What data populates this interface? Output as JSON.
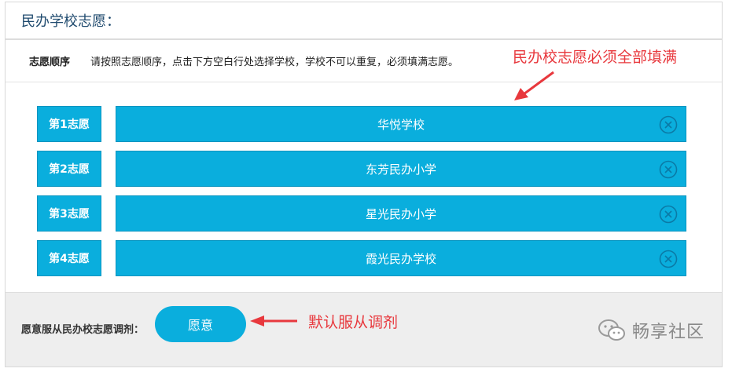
{
  "header": {
    "title": "民办学校志愿："
  },
  "instructions": {
    "label": "志愿顺序",
    "text": "请按照志愿顺序，点击下方空白行处选择学校，学校不可以重复，必须填满志愿。"
  },
  "choices": [
    {
      "rank": "第1志愿",
      "school": "华悦学校"
    },
    {
      "rank": "第2志愿",
      "school": "东芳民办小学"
    },
    {
      "rank": "第3志愿",
      "school": "星光民办小学"
    },
    {
      "rank": "第4志愿",
      "school": "霞光民办学校"
    }
  ],
  "footer": {
    "adjust_label": "愿意服从民办校志愿调剂：",
    "agree_button": "愿意"
  },
  "annotations": {
    "top_note": "民办校志愿必须全部填满",
    "bottom_note": "默认服从调剂"
  },
  "watermark": {
    "text": "畅享社区",
    "icon": "wechat-icon"
  },
  "colors": {
    "accent": "#0aaedd",
    "annotation": "#e8383d",
    "title": "#1f4a6e"
  }
}
